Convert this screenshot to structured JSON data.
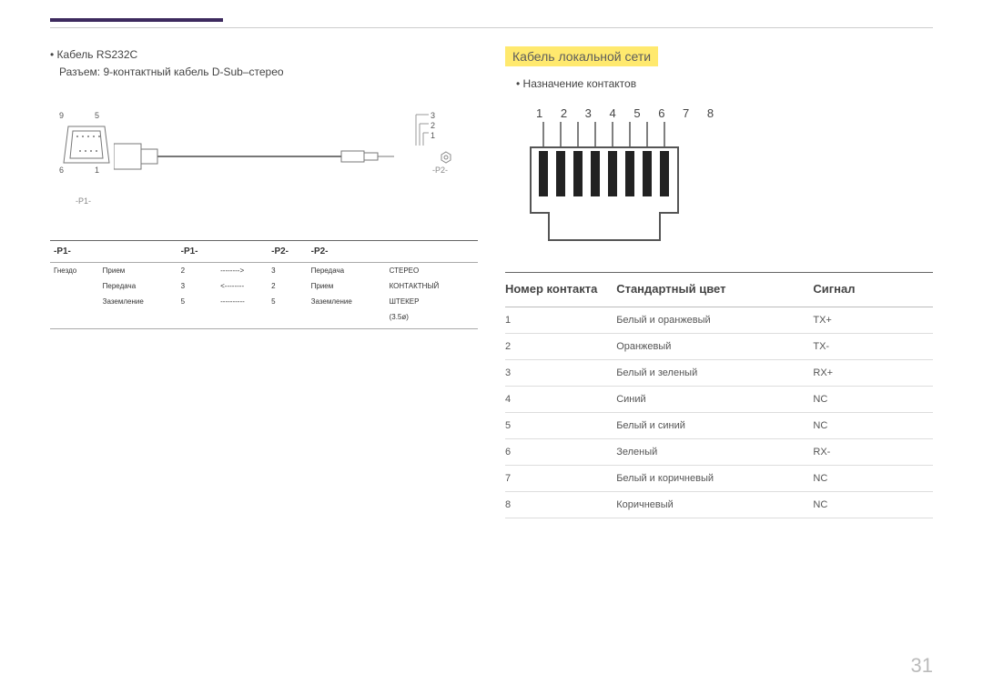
{
  "page_number": "31",
  "left": {
    "bullet_title": "Кабель RS232C",
    "connector_desc": "Разъем: 9-контактный кабель D-Sub–стерео",
    "dsub_nums": {
      "tl": "9",
      "tr": "5",
      "bl": "6",
      "br": "1"
    },
    "jack_nums": [
      "3",
      "2",
      "1"
    ],
    "p1_label": "-P1-",
    "p2_label": "-P2-",
    "table": {
      "headers": [
        "-P1-",
        "-P1-",
        "-P2-",
        "-P2-"
      ],
      "rows": [
        [
          "Гнездо",
          "Прием",
          "2",
          "-------->",
          "3",
          "Передача",
          "СТЕРЕО"
        ],
        [
          "",
          "Передача",
          "3",
          "<--------",
          "2",
          "Прием",
          "КОНТАКТНЫЙ"
        ],
        [
          "",
          "Заземление",
          "5",
          "----------",
          "5",
          "Заземление",
          "ШТЕКЕР"
        ],
        [
          "",
          "",
          "",
          "",
          "",
          "",
          "(3.5ø)"
        ]
      ]
    }
  },
  "right": {
    "section_title": "Кабель локальной сети",
    "bullet_title": "Назначение контактов",
    "rj45_nums": "1 2 3 4 5 6 7 8",
    "table": {
      "headers": [
        "Номер контакта",
        "Стандартный цвет",
        "Сигнал"
      ],
      "rows": [
        [
          "1",
          "Белый и оранжевый",
          "TX+"
        ],
        [
          "2",
          "Оранжевый",
          "TX-"
        ],
        [
          "3",
          "Белый и зеленый",
          "RX+"
        ],
        [
          "4",
          "Синий",
          "NC"
        ],
        [
          "5",
          "Белый и синий",
          "NC"
        ],
        [
          "6",
          "Зеленый",
          "RX-"
        ],
        [
          "7",
          "Белый и коричневый",
          "NC"
        ],
        [
          "8",
          "Коричневый",
          "NC"
        ]
      ]
    }
  }
}
